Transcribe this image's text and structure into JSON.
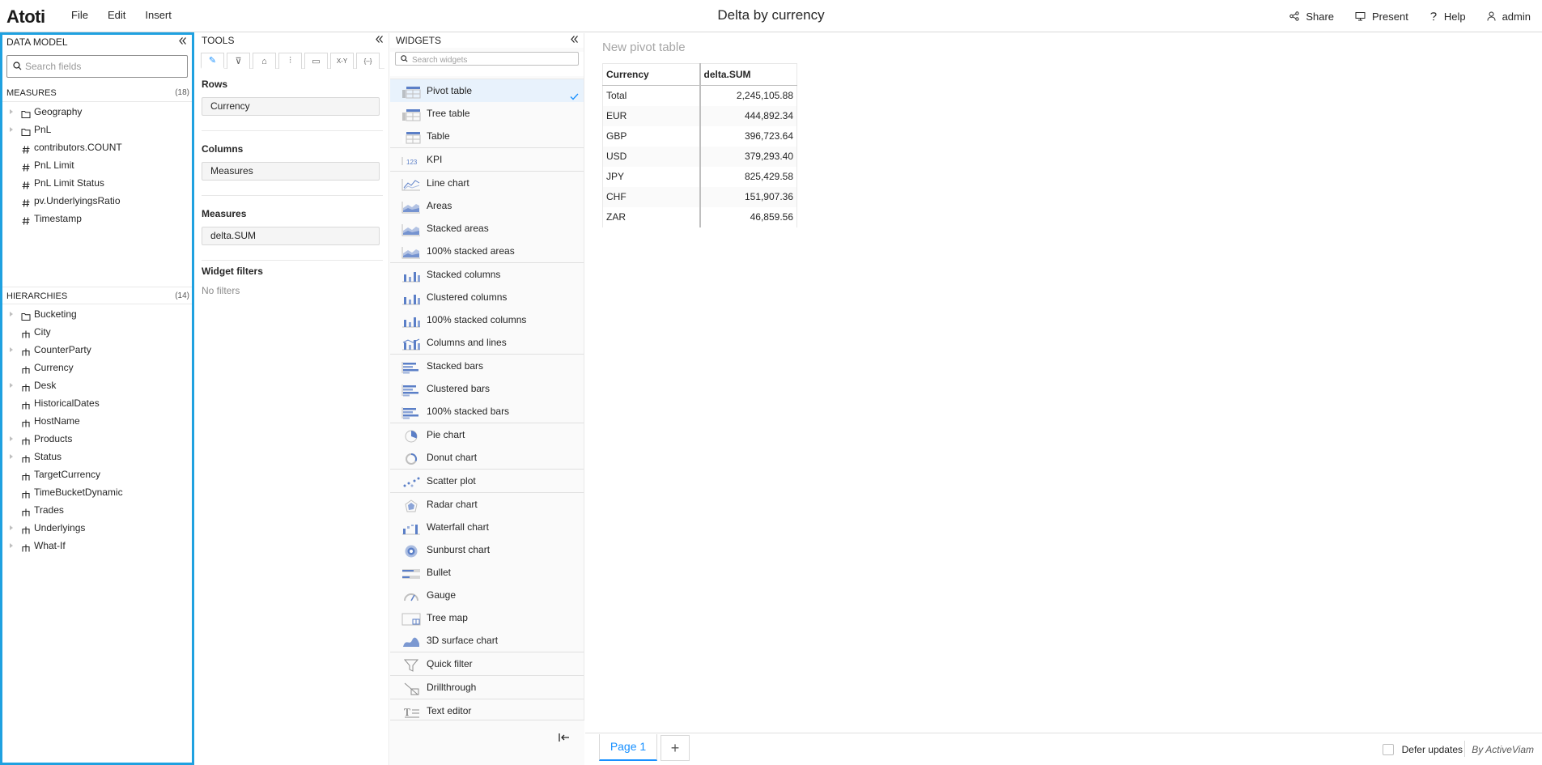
{
  "header": {
    "logo": "Atoti",
    "menu": [
      "File",
      "Edit",
      "Insert"
    ],
    "title": "Delta by currency",
    "actions": [
      {
        "label": "Share",
        "icon": "share-icon"
      },
      {
        "label": "Present",
        "icon": "monitor-icon"
      },
      {
        "label": "Help",
        "icon": "help-icon"
      },
      {
        "label": "admin",
        "icon": "user-icon"
      }
    ]
  },
  "data_model": {
    "title": "DATA MODEL",
    "search_placeholder": "Search fields",
    "measures": {
      "label": "MEASURES",
      "count": "(18)",
      "items": [
        {
          "label": "Geography",
          "type": "folder",
          "expandable": true
        },
        {
          "label": "PnL",
          "type": "folder",
          "expandable": true
        },
        {
          "label": "contributors.COUNT",
          "type": "measure",
          "expandable": false
        },
        {
          "label": "PnL Limit",
          "type": "measure",
          "expandable": false
        },
        {
          "label": "PnL Limit Status",
          "type": "measure",
          "expandable": false
        },
        {
          "label": "pv.UnderlyingsRatio",
          "type": "measure",
          "expandable": false
        },
        {
          "label": "Timestamp",
          "type": "measure",
          "expandable": false
        }
      ]
    },
    "hierarchies": {
      "label": "HIERARCHIES",
      "count": "(14)",
      "items": [
        {
          "label": "Bucketing",
          "type": "folder",
          "expandable": true
        },
        {
          "label": "City",
          "type": "hierarchy",
          "expandable": false
        },
        {
          "label": "CounterParty",
          "type": "hierarchy",
          "expandable": true
        },
        {
          "label": "Currency",
          "type": "hierarchy",
          "expandable": false
        },
        {
          "label": "Desk",
          "type": "hierarchy",
          "expandable": true
        },
        {
          "label": "HistoricalDates",
          "type": "hierarchy",
          "expandable": false
        },
        {
          "label": "HostName",
          "type": "hierarchy",
          "expandable": false
        },
        {
          "label": "Products",
          "type": "hierarchy",
          "expandable": true
        },
        {
          "label": "Status",
          "type": "hierarchy",
          "expandable": true
        },
        {
          "label": "TargetCurrency",
          "type": "hierarchy",
          "expandable": false
        },
        {
          "label": "TimeBucketDynamic",
          "type": "hierarchy",
          "expandable": false
        },
        {
          "label": "Trades",
          "type": "hierarchy",
          "expandable": false
        },
        {
          "label": "Underlyings",
          "type": "hierarchy",
          "expandable": true
        },
        {
          "label": "What-If",
          "type": "hierarchy",
          "expandable": true
        }
      ]
    }
  },
  "tools": {
    "title": "TOOLS",
    "tabs": [
      {
        "name": "edit-tab",
        "glyph": "✎"
      },
      {
        "name": "filter-tab",
        "glyph": "⊽"
      },
      {
        "name": "style-tab",
        "glyph": "⌂"
      },
      {
        "name": "settings-tab",
        "glyph": "⫶"
      },
      {
        "name": "query-tab",
        "glyph": "▭"
      },
      {
        "name": "xy-tab",
        "glyph": "X-Y"
      },
      {
        "name": "json-tab",
        "glyph": "{–}"
      }
    ],
    "rows_label": "Rows",
    "rows_value": "Currency",
    "columns_label": "Columns",
    "columns_value": "Measures",
    "measures_label": "Measures",
    "measures_value": "delta.SUM",
    "filters_label": "Widget filters",
    "filters_empty": "No filters"
  },
  "widgets": {
    "title": "WIDGETS",
    "search_placeholder": "Search widgets",
    "groups": [
      [
        {
          "label": "Pivot table",
          "icon": "pivot-table-icon",
          "selected": true
        },
        {
          "label": "Tree table",
          "icon": "tree-table-icon"
        },
        {
          "label": "Table",
          "icon": "table-icon"
        }
      ],
      [
        {
          "label": "KPI",
          "icon": "kpi-icon"
        }
      ],
      [
        {
          "label": "Line chart",
          "icon": "line-chart-icon"
        },
        {
          "label": "Areas",
          "icon": "area-chart-icon"
        },
        {
          "label": "Stacked areas",
          "icon": "stacked-areas-icon"
        },
        {
          "label": "100% stacked areas",
          "icon": "stacked-areas-100-icon"
        }
      ],
      [
        {
          "label": "Stacked columns",
          "icon": "stacked-columns-icon"
        },
        {
          "label": "Clustered columns",
          "icon": "clustered-columns-icon"
        },
        {
          "label": "100% stacked columns",
          "icon": "stacked-columns-100-icon"
        },
        {
          "label": "Columns and lines",
          "icon": "columns-lines-icon"
        }
      ],
      [
        {
          "label": "Stacked bars",
          "icon": "stacked-bars-icon"
        },
        {
          "label": "Clustered bars",
          "icon": "clustered-bars-icon"
        },
        {
          "label": "100% stacked bars",
          "icon": "stacked-bars-100-icon"
        }
      ],
      [
        {
          "label": "Pie chart",
          "icon": "pie-chart-icon"
        },
        {
          "label": "Donut chart",
          "icon": "donut-chart-icon"
        }
      ],
      [
        {
          "label": "Scatter plot",
          "icon": "scatter-plot-icon"
        }
      ],
      [
        {
          "label": "Radar chart",
          "icon": "radar-chart-icon"
        },
        {
          "label": "Waterfall chart",
          "icon": "waterfall-chart-icon"
        },
        {
          "label": "Sunburst chart",
          "icon": "sunburst-chart-icon"
        },
        {
          "label": "Bullet",
          "icon": "bullet-chart-icon"
        },
        {
          "label": "Gauge",
          "icon": "gauge-icon"
        },
        {
          "label": "Tree map",
          "icon": "tree-map-icon"
        },
        {
          "label": "3D surface chart",
          "icon": "surface-chart-icon"
        }
      ],
      [
        {
          "label": "Quick filter",
          "icon": "quick-filter-icon"
        }
      ],
      [
        {
          "label": "Drillthrough",
          "icon": "drillthrough-icon"
        }
      ],
      [
        {
          "label": "Text editor",
          "icon": "text-editor-icon"
        }
      ]
    ]
  },
  "main": {
    "widget_title": "New pivot table",
    "pivot": {
      "headers": [
        "Currency",
        "delta.SUM"
      ],
      "rows": [
        [
          "Total",
          "2,245,105.88"
        ],
        [
          "EUR",
          "444,892.34"
        ],
        [
          "GBP",
          "396,723.64"
        ],
        [
          "USD",
          "379,293.40"
        ],
        [
          "JPY",
          "825,429.58"
        ],
        [
          "CHF",
          "151,907.36"
        ],
        [
          "ZAR",
          "46,859.56"
        ]
      ]
    },
    "footer": {
      "page_tab": "Page 1",
      "add_page": "+",
      "defer_label": "Defer updates",
      "defer_checked": false,
      "brand": "By ActiveViam"
    }
  },
  "colors": {
    "accent": "#1890ff",
    "highlight_border": "#1fa1e0",
    "selected_bg": "#e8f2fc",
    "icon_blue": "#5b7fc7"
  }
}
